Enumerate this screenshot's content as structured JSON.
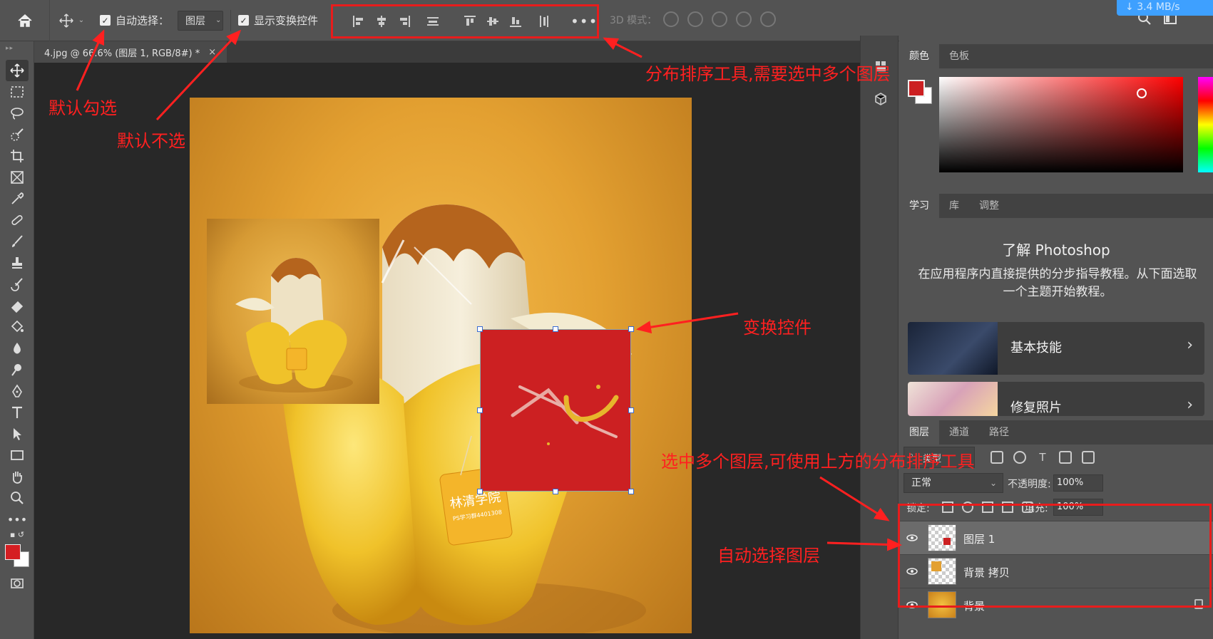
{
  "options_bar": {
    "auto_select_label": "自动选择：",
    "auto_select_target": "图层",
    "show_transform_label": "显示变换控件",
    "mode_3d_label": "3D 模式：",
    "more_label": "•••",
    "speed": "3.4 MB/s"
  },
  "document": {
    "tab_title": "4.jpg @ 66.6% (图层 1, RGB/8#) *",
    "close_glyph": "×"
  },
  "panels": {
    "color_tabs": [
      "颜色",
      "色板"
    ],
    "learn_tabs": [
      "学习",
      "库",
      "调整"
    ],
    "learn_title": "了解 Photoshop",
    "learn_desc": "在应用程序内直接提供的分步指导教程。从下面选取一个主题开始教程。",
    "learn_cards": [
      {
        "label": "基本技能"
      },
      {
        "label": "修复照片"
      }
    ],
    "layers_tabs": [
      "图层",
      "通道",
      "路径"
    ],
    "kind_label": "类型",
    "blend_mode": "正常",
    "opacity_label": "不透明度:",
    "opacity_value": "100%",
    "lock_label": "锁定:",
    "fill_label": "填充:",
    "fill_value": "100%",
    "layers": [
      {
        "name": "图层 1",
        "selected": true
      },
      {
        "name": "背景 拷贝",
        "selected": false
      },
      {
        "name": "背景",
        "selected": false,
        "locked": true
      }
    ]
  },
  "artwork": {
    "tag_text": "林清学院",
    "tag_sub": "PS学习群4401308"
  },
  "annotations": {
    "default_checked": "默认勾选",
    "default_unchecked": "默认不选",
    "distribute_tools": "分布排序工具,需要选中多个图层",
    "transform_controls": "变换控件",
    "multi_layers": "选中多个图层,可使用上方的分布排序工具",
    "auto_select_layer": "自动选择图层"
  },
  "colors": {
    "annotation_red": "#ff2020",
    "foreground": "#cc2022",
    "panel_bg": "#535353"
  }
}
